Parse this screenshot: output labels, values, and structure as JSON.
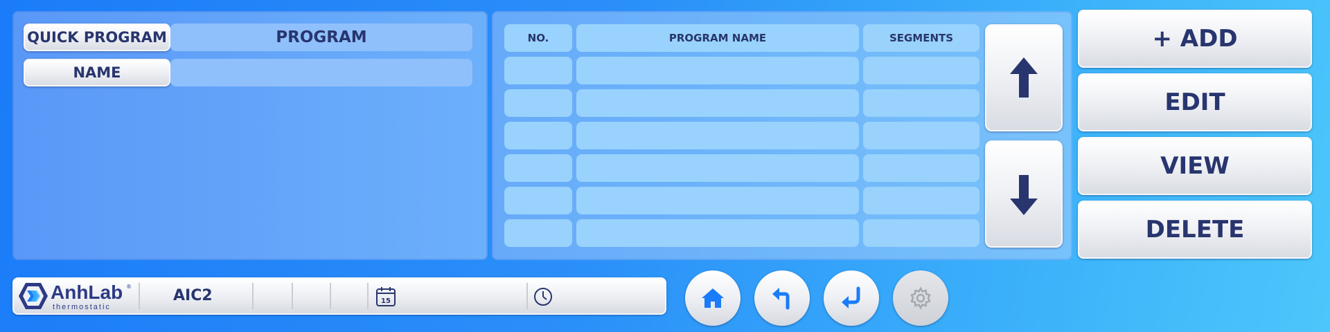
{
  "left_panel": {
    "quick_program_label": "QUICK PROGRAM",
    "program_value": "PROGRAM",
    "name_label": "NAME",
    "name_value": ""
  },
  "program_table": {
    "headers": {
      "no": "NO.",
      "name": "PROGRAM NAME",
      "segments": "SEGMENTS"
    },
    "rows": [
      {
        "no": "",
        "name": "",
        "segments": ""
      },
      {
        "no": "",
        "name": "",
        "segments": ""
      },
      {
        "no": "",
        "name": "",
        "segments": ""
      },
      {
        "no": "",
        "name": "",
        "segments": ""
      },
      {
        "no": "",
        "name": "",
        "segments": ""
      },
      {
        "no": "",
        "name": "",
        "segments": ""
      }
    ]
  },
  "actions": {
    "add_label": "+ ADD",
    "edit_label": "EDIT",
    "view_label": "VIEW",
    "delete_label": "DELETE"
  },
  "status_bar": {
    "logo_text": "AnhLab",
    "logo_sub": "thermostatic",
    "logo_reg": "®",
    "device": "AIC2",
    "date_icon": "calendar-icon",
    "date_icon_day": "15",
    "time_icon": "clock-icon",
    "date": "",
    "time": ""
  },
  "nav": {
    "home": "home-icon",
    "back": "back-arrow-icon",
    "enter": "enter-icon",
    "settings": "gear-icon"
  },
  "colors": {
    "accent_dark": "#28356e",
    "nav_icon_blue": "#1a7cf8",
    "settings_disabled": "#a5a8af"
  }
}
